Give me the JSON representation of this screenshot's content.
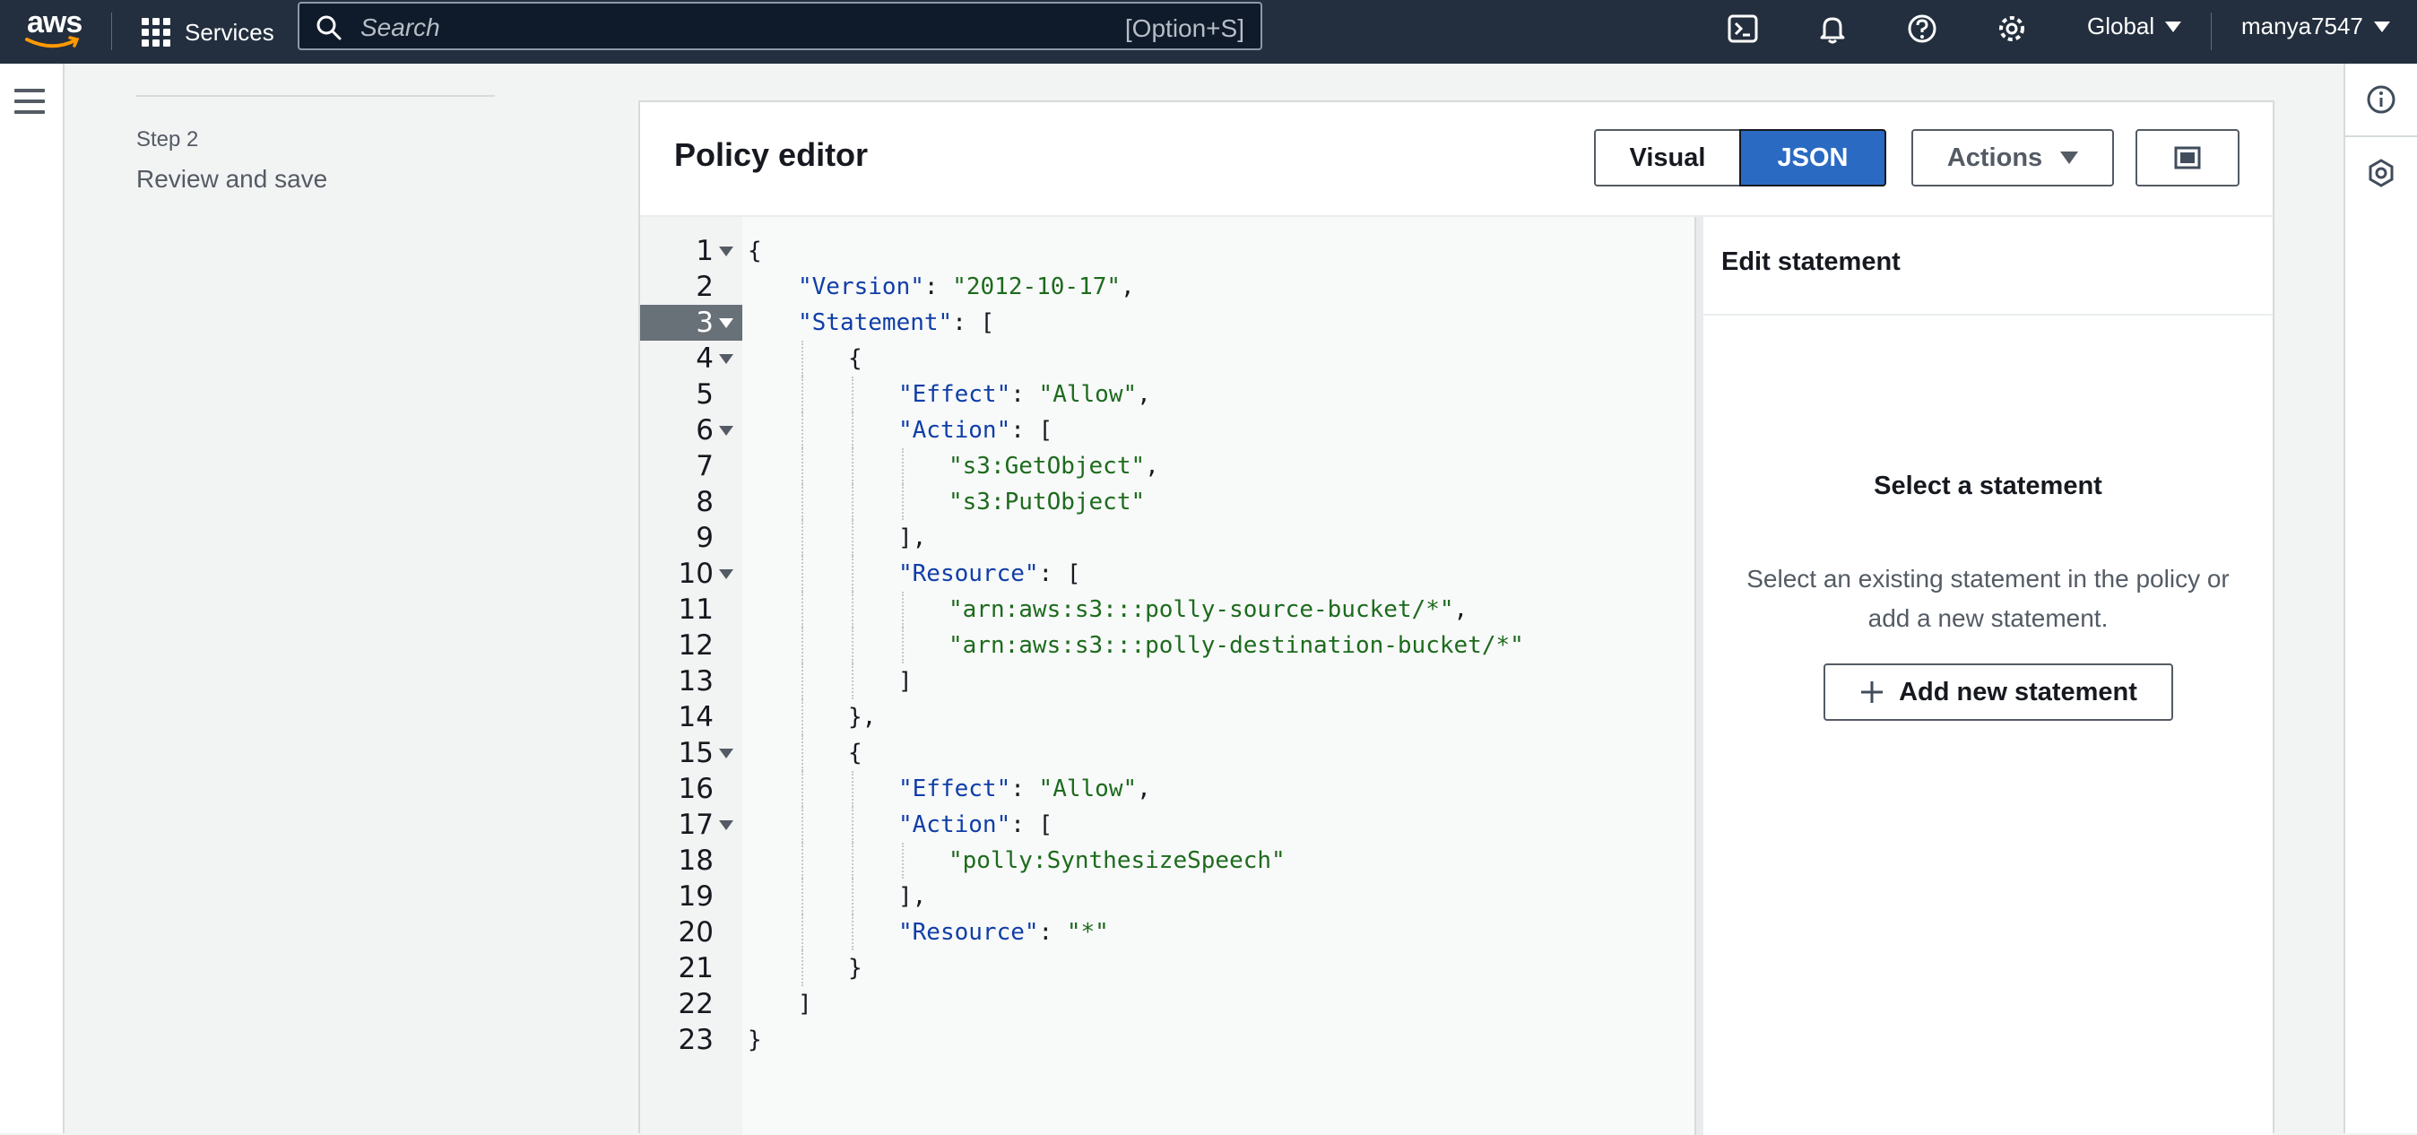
{
  "topnav": {
    "logo_text": "aws",
    "services_label": "Services",
    "search_placeholder": "Search",
    "search_shortcut": "[Option+S]",
    "region": "Global",
    "user": "manya7547"
  },
  "steps": {
    "step_label": "Step 2",
    "step_title": "Review and save"
  },
  "editor": {
    "title": "Policy editor",
    "visual_label": "Visual",
    "json_label": "JSON",
    "actions_label": "Actions",
    "active_line": 3,
    "lines": [
      {
        "n": "1",
        "fold": true,
        "indent": 0,
        "html": "{"
      },
      {
        "n": "2",
        "fold": false,
        "indent": 1,
        "html": "<span class='k'>\"Version\"</span>: <span class='s'>\"2012-10-17\"</span>,"
      },
      {
        "n": "3",
        "fold": true,
        "indent": 1,
        "html": "<span class='k'>\"Statement\"</span>: ["
      },
      {
        "n": "4",
        "fold": true,
        "indent": 2,
        "html": "{"
      },
      {
        "n": "5",
        "fold": false,
        "indent": 3,
        "html": "<span class='k'>\"Effect\"</span>: <span class='s'>\"Allow\"</span>,"
      },
      {
        "n": "6",
        "fold": true,
        "indent": 3,
        "html": "<span class='k'>\"Action\"</span>: ["
      },
      {
        "n": "7",
        "fold": false,
        "indent": 4,
        "html": "<span class='s'>\"s3:GetObject\"</span>,"
      },
      {
        "n": "8",
        "fold": false,
        "indent": 4,
        "html": "<span class='s'>\"s3:PutObject\"</span>"
      },
      {
        "n": "9",
        "fold": false,
        "indent": 3,
        "html": "],"
      },
      {
        "n": "10",
        "fold": true,
        "indent": 3,
        "html": "<span class='k'>\"Resource\"</span>: ["
      },
      {
        "n": "11",
        "fold": false,
        "indent": 4,
        "html": "<span class='s'>\"arn:aws:s3:::polly-source-bucket/*\"</span>,"
      },
      {
        "n": "12",
        "fold": false,
        "indent": 4,
        "html": "<span class='s'>\"arn:aws:s3:::polly-destination-bucket/*\"</span>"
      },
      {
        "n": "13",
        "fold": false,
        "indent": 3,
        "html": "]"
      },
      {
        "n": "14",
        "fold": false,
        "indent": 2,
        "html": "},"
      },
      {
        "n": "15",
        "fold": true,
        "indent": 2,
        "html": "{"
      },
      {
        "n": "16",
        "fold": false,
        "indent": 3,
        "html": "<span class='k'>\"Effect\"</span>: <span class='s'>\"Allow\"</span>,"
      },
      {
        "n": "17",
        "fold": true,
        "indent": 3,
        "html": "<span class='k'>\"Action\"</span>: ["
      },
      {
        "n": "18",
        "fold": false,
        "indent": 4,
        "html": "<span class='s'>\"polly:SynthesizeSpeech\"</span>"
      },
      {
        "n": "19",
        "fold": false,
        "indent": 3,
        "html": "],"
      },
      {
        "n": "20",
        "fold": false,
        "indent": 3,
        "html": "<span class='k'>\"Resource\"</span>: <span class='s'>\"*\"</span>"
      },
      {
        "n": "21",
        "fold": false,
        "indent": 2,
        "html": "}"
      },
      {
        "n": "22",
        "fold": false,
        "indent": 1,
        "html": "]"
      },
      {
        "n": "23",
        "fold": false,
        "indent": 0,
        "html": "}"
      }
    ]
  },
  "edit_statement": {
    "header": "Edit statement",
    "select_title": "Select a statement",
    "select_desc": "Select an existing statement in the policy or add a new statement.",
    "add_label": "Add new statement"
  },
  "colors": {
    "nav_bg": "#232f3e",
    "primary": "#2a6ac3",
    "json_key": "#0f3ea8",
    "json_string": "#1d6b1d"
  }
}
